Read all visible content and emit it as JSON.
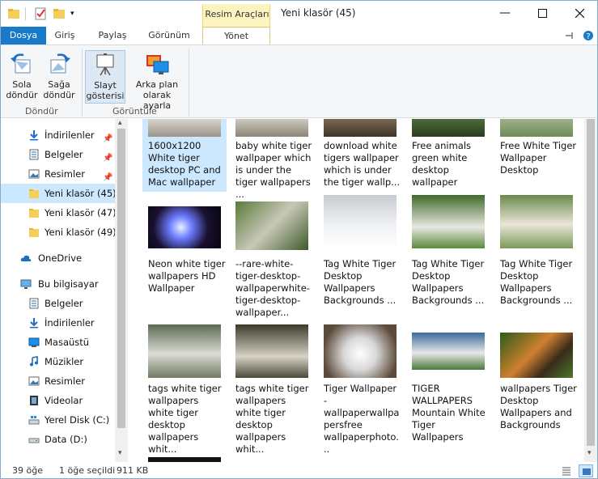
{
  "window": {
    "title": "Yeni klasör (45)",
    "context_group": "Resim Araçları"
  },
  "tabs": {
    "file": "Dosya",
    "home": "Giriş",
    "share": "Paylaş",
    "view": "Görünüm",
    "manage": "Yönet"
  },
  "ribbon": {
    "rotate_left": "Sola\ndöndür",
    "rotate_right": "Sağa\ndöndür",
    "rotate_group": "Döndür",
    "slideshow": "Slayt\ngösterisi",
    "set_background": "Arka plan\nolarak ayarla",
    "view_group": "Görüntüle"
  },
  "sidebar": {
    "downloads": "İndirilenler",
    "documents": "Belgeler",
    "pictures": "Resimler",
    "folder45": "Yeni klasör (45)",
    "folder47": "Yeni klasör (47)",
    "folder49": "Yeni klasör (49)",
    "onedrive": "OneDrive",
    "this_pc": "Bu bilgisayar",
    "pc_documents": "Belgeler",
    "pc_downloads": "İndirilenler",
    "desktop": "Masaüstü",
    "music": "Müzikler",
    "pc_pictures": "Resimler",
    "videos": "Videolar",
    "local_disk": "Yerel Disk (C:)",
    "data_disk": "Data (D:)"
  },
  "files": [
    {
      "name": "1600x1200 White tiger desktop PC and Mac wallpaper"
    },
    {
      "name": "baby white tiger wallpaper which is under the tiger wallpapers ..."
    },
    {
      "name": "download white tigers wallpaper which is under the tiger wallp..."
    },
    {
      "name": "Free animals green white desktop wallpaper"
    },
    {
      "name": "Free White Tiger Wallpaper Desktop"
    },
    {
      "name": "Neon white tiger wallpapers  HD Wallpaper"
    },
    {
      "name": "--rare-white-tiger-desktop-wallpaperwhite-tiger-desktop-wallpaper..."
    },
    {
      "name": "Tag White Tiger Desktop Wallpapers Backgrounds ..."
    },
    {
      "name": "Tag White Tiger Desktop Wallpapers Backgrounds ..."
    },
    {
      "name": "Tag White Tiger Desktop Wallpapers Backgrounds ..."
    },
    {
      "name": "tags white tiger wallpapers white tiger desktop wallpapers whit..."
    },
    {
      "name": "tags white tiger wallpapers white tiger desktop wallpapers whit..."
    },
    {
      "name": "Tiger Wallpaper - wallpaperwallpapersfree wallpaperphoto..."
    },
    {
      "name": "TIGER WALLPAPERS Mountain White Tiger Wallpapers"
    },
    {
      "name": "wallpapers Tiger Desktop Wallpapers and Backgrounds"
    }
  ],
  "status": {
    "count": "39 öğe",
    "selection": "1 öğe seçildi",
    "size": "911 KB"
  },
  "colors": {
    "accent": "#1979ca",
    "selection": "#cce8ff",
    "context": "#fdf3bf"
  }
}
